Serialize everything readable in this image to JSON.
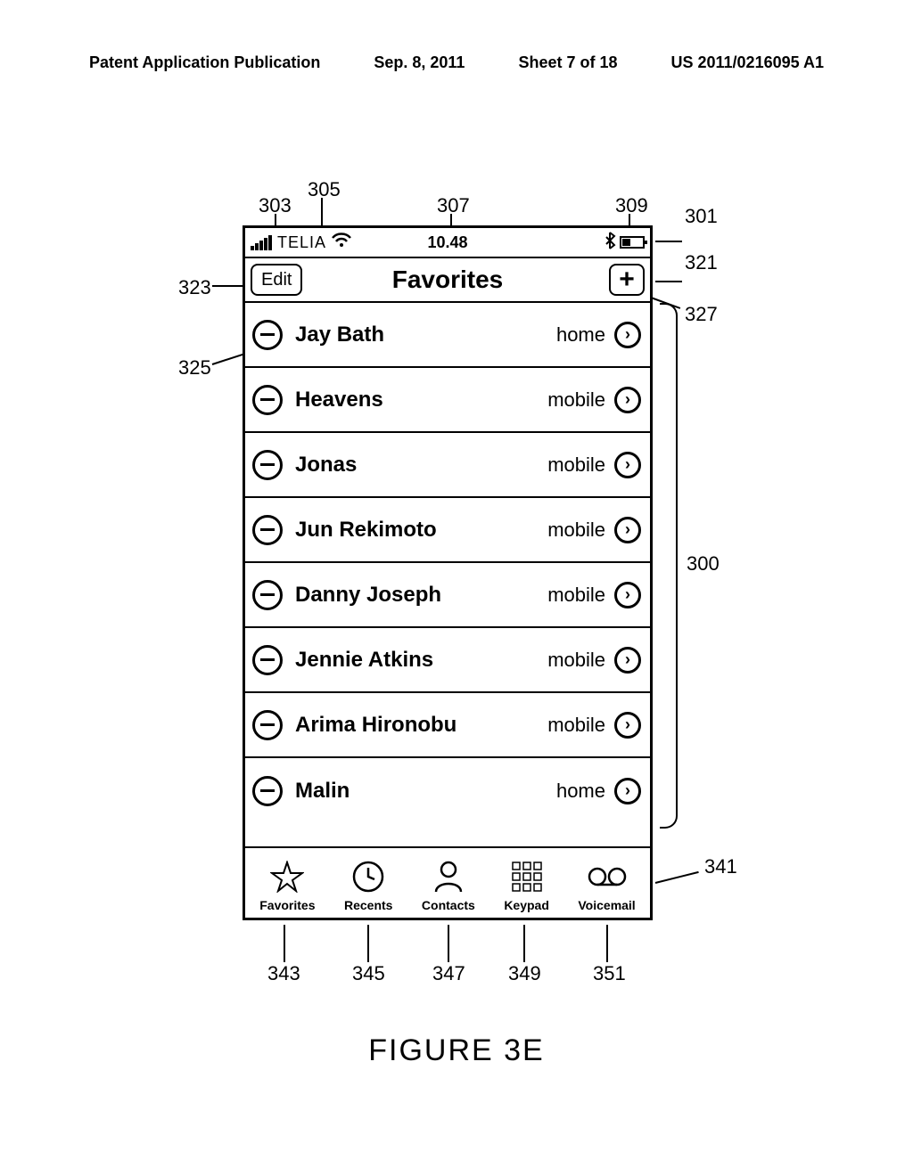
{
  "header": {
    "left": "Patent Application Publication",
    "date": "Sep. 8, 2011",
    "sheet": "Sheet 7 of 18",
    "pubno": "US 2011/0216095 A1"
  },
  "statusbar": {
    "carrier": "TELIA",
    "time": "10.48"
  },
  "navbar": {
    "edit": "Edit",
    "title": "Favorites",
    "plus": "+"
  },
  "rows": [
    {
      "name": "Jay Bath",
      "type": "home"
    },
    {
      "name": "Heavens",
      "type": "mobile"
    },
    {
      "name": "Jonas",
      "type": "mobile"
    },
    {
      "name": "Jun Rekimoto",
      "type": "mobile"
    },
    {
      "name": "Danny Joseph",
      "type": "mobile"
    },
    {
      "name": "Jennie Atkins",
      "type": "mobile"
    },
    {
      "name": "Arima Hironobu",
      "type": "mobile"
    },
    {
      "name": "Malin",
      "type": "home"
    }
  ],
  "tabs": {
    "favorites": "Favorites",
    "recents": "Recents",
    "contacts": "Contacts",
    "keypad": "Keypad",
    "voicemail": "Voicemail"
  },
  "refs": {
    "r300": "300",
    "r301": "301",
    "r303": "303",
    "r305": "305",
    "r307": "307",
    "r309": "309",
    "r321": "321",
    "r323": "323",
    "r325": "325",
    "r327": "327",
    "r341": "341",
    "r343": "343",
    "r345": "345",
    "r347": "347",
    "r349": "349",
    "r351": "351"
  },
  "figure_label": "FIGURE 3E"
}
